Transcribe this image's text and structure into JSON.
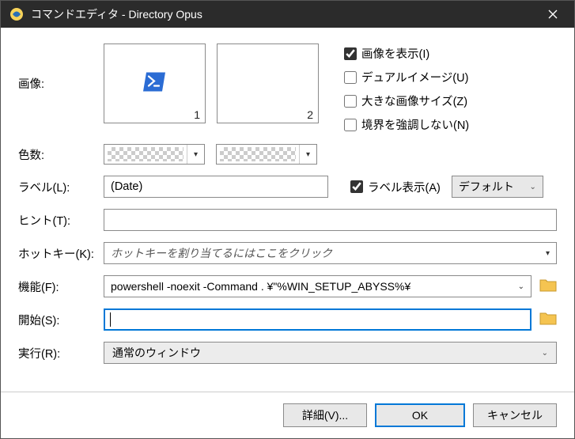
{
  "window": {
    "title": "コマンドエディタ - Directory Opus"
  },
  "labels": {
    "image": "画像:",
    "colors": "色数:",
    "label": "ラベル(L):",
    "hint": "ヒント(T):",
    "hotkey": "ホットキー(K):",
    "function": "機能(F):",
    "startin": "開始(S):",
    "run": "実行(R):"
  },
  "image_boxes": {
    "one": "1",
    "two": "2"
  },
  "checks": {
    "show_image": {
      "label": "画像を表示(I)",
      "checked": true
    },
    "dual_image": {
      "label": "デュアルイメージ(U)",
      "checked": false
    },
    "large_image": {
      "label": "大きな画像サイズ(Z)",
      "checked": false
    },
    "no_border": {
      "label": "境界を強調しない(N)",
      "checked": false
    },
    "show_label": {
      "label": "ラベル表示(A)",
      "checked": true
    }
  },
  "fields": {
    "label_value": "(Date)",
    "hint_value": "",
    "hotkey_placeholder": "ホットキーを割り当てるにはここをクリック",
    "function_value": "powershell -noexit -Command . ¥\"%WIN_SETUP_ABYSS%¥",
    "startin_value": "",
    "run_value": "通常のウィンドウ",
    "default_label": "デフォルト"
  },
  "buttons": {
    "advanced": "詳細(V)...",
    "ok": "OK",
    "cancel": "キャンセル"
  }
}
